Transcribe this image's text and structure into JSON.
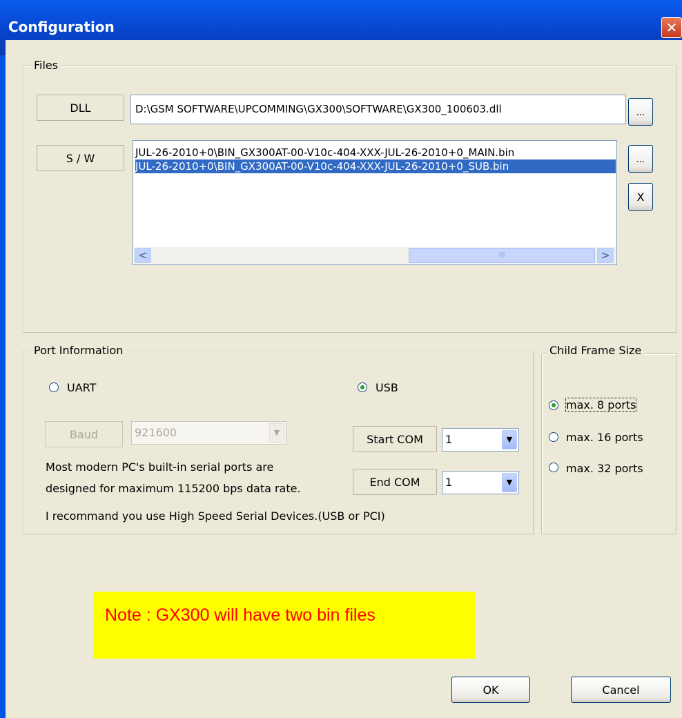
{
  "window": {
    "title": "Configuration",
    "close_glyph": "✕"
  },
  "files": {
    "legend": "Files",
    "dll_label": "DLL",
    "dll_path": "D:\\GSM SOFTWARE\\UPCOMMING\\GX300\\SOFTWARE\\GX300_100603.dll",
    "browse_label": "...",
    "sw_label": "S / W",
    "sw_items": [
      "JUL-26-2010+0\\BIN_GX300AT-00-V10c-404-XXX-JUL-26-2010+0_MAIN.bin",
      "JUL-26-2010+0\\BIN_GX300AT-00-V10c-404-XXX-JUL-26-2010+0_SUB.bin"
    ],
    "sw_selected_index": 1,
    "remove_label": "X",
    "scroll_left": "<",
    "scroll_right": ">",
    "scroll_thumb_grip": "III"
  },
  "port": {
    "legend": "Port Information",
    "uart_label": "UART",
    "usb_label": "USB",
    "selected": "USB",
    "baud_label": "Baud",
    "baud_value": "921600",
    "start_com_label": "Start COM",
    "start_com_value": "1",
    "end_com_label": "End COM",
    "end_com_value": "1",
    "info_line1": "Most modern PC's built-in serial ports are",
    "info_line2": "designed for maximum 115200 bps data rate.",
    "recommend": "I recommand you use High Speed Serial Devices.(USB or PCI)",
    "dropdown_glyph": "▼"
  },
  "child_frame": {
    "legend": "Child Frame Size",
    "options": [
      "max. 8 ports",
      "max. 16 ports",
      "max. 32 ports"
    ],
    "selected_index": 0
  },
  "note": {
    "text": "Note : GX300 will have two bin files",
    "bg_color": "#ffff00",
    "text_color": "#ff0000"
  },
  "buttons": {
    "ok": "OK",
    "cancel": "Cancel"
  }
}
